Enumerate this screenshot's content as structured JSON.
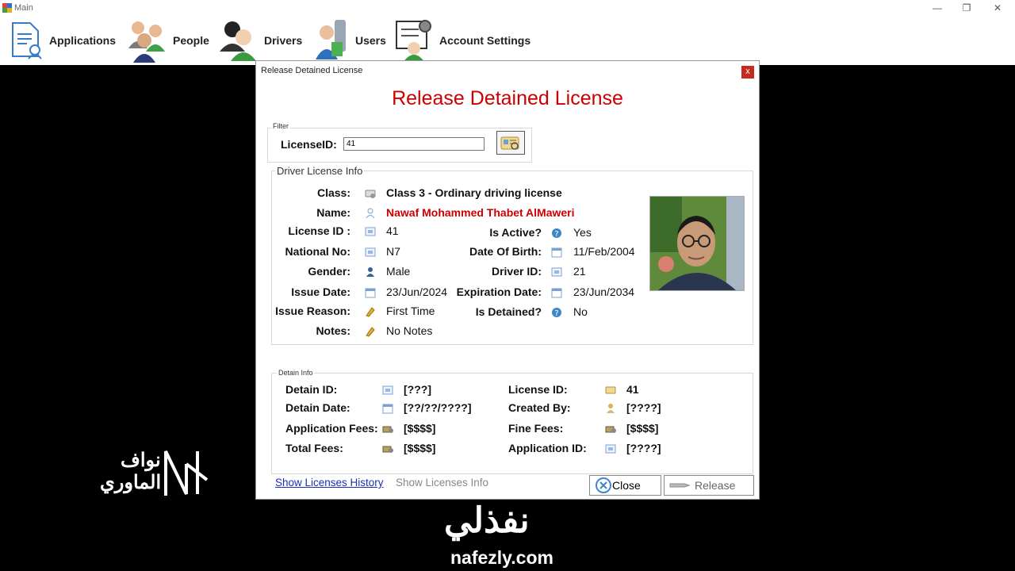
{
  "window": {
    "title": "Main",
    "minimize": "—",
    "restore": "❐",
    "close": "✕"
  },
  "menu": [
    {
      "label": "Applications",
      "icon": "applications-icon"
    },
    {
      "label": "People",
      "icon": "people-icon"
    },
    {
      "label": "Drivers",
      "icon": "drivers-icon"
    },
    {
      "label": "Users",
      "icon": "users-icon"
    },
    {
      "label": "Account Settings",
      "icon": "account-settings-icon"
    }
  ],
  "dialog": {
    "title": "Release Detained License",
    "close": "x",
    "heading": "Release Detained License",
    "filter": {
      "legend": "Filter",
      "label": "LicenseID:",
      "value": "41"
    },
    "driver_info": {
      "legend": "Driver License Info",
      "class_label": "Class:",
      "class_value": "Class 3 - Ordinary driving license",
      "name_label": "Name:",
      "name_value": "Nawaf Mohammed Thabet AlMaweri",
      "license_id_label": "License ID :",
      "license_id_value": "41",
      "national_no_label": "National No:",
      "national_no_value": "N7",
      "gender_label": "Gender:",
      "gender_value": "Male",
      "issue_date_label": "Issue Date:",
      "issue_date_value": "23/Jun/2024",
      "issue_reason_label": "Issue Reason:",
      "issue_reason_value": "First Time",
      "notes_label": "Notes:",
      "notes_value": "No Notes",
      "is_active_label": "Is Active?",
      "is_active_value": "Yes",
      "dob_label": "Date Of Birth:",
      "dob_value": "11/Feb/2004",
      "driver_id_label": "Driver ID:",
      "driver_id_value": "21",
      "expiration_label": "Expiration Date:",
      "expiration_value": "23/Jun/2034",
      "is_detained_label": "Is Detained?",
      "is_detained_value": "No"
    },
    "detain_info": {
      "legend": "Detain Info",
      "detain_id_label": "Detain ID:",
      "detain_id_value": "[???]",
      "detain_date_label": "Detain Date:",
      "detain_date_value": "[??/??/????]",
      "app_fees_label": "Application Fees:",
      "app_fees_value": "[$$$$]",
      "total_fees_label": "Total Fees:",
      "total_fees_value": "[$$$$]",
      "license_id_label": "License ID:",
      "license_id_value": "41",
      "created_by_label": "Created By:",
      "created_by_value": "[????]",
      "fine_fees_label": "Fine Fees:",
      "fine_fees_value": "[$$$$]",
      "application_id_label": "Application ID:",
      "application_id_value": "[????]"
    },
    "links": {
      "history": "Show Licenses History",
      "info": "Show Licenses Info"
    },
    "buttons": {
      "close": "Close",
      "release": "Release"
    }
  },
  "watermarks": {
    "author_line1": "نواف",
    "author_line2": "الماوري",
    "brand_ar": "نفذلي",
    "brand_en": "nafezly.com"
  },
  "colors": {
    "accent_red": "#cc0000",
    "link_blue": "#1b2fb8",
    "close_red": "#c42b1c"
  }
}
